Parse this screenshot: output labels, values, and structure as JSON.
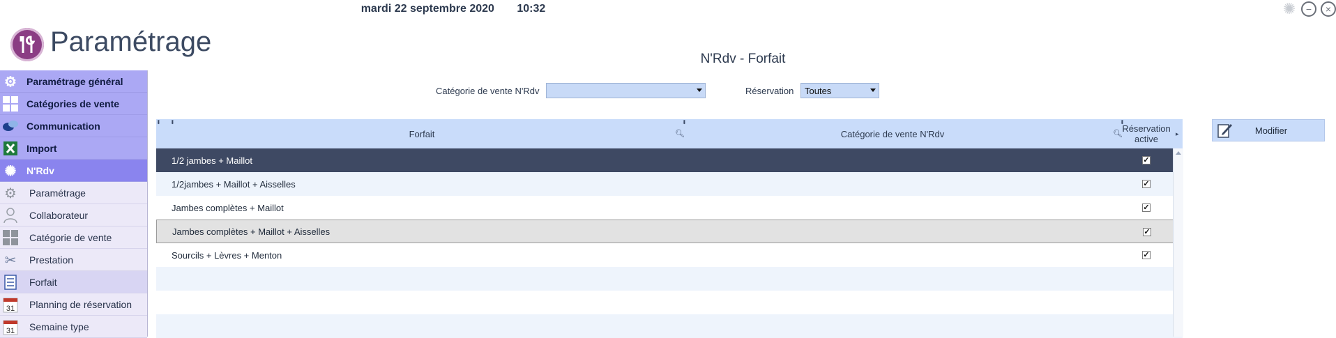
{
  "header": {
    "date": "mardi 22 septembre 2020",
    "time": "10:32",
    "app_title": "Paramétrage",
    "page_title": "N'Rdv - Forfait"
  },
  "window_controls": {
    "loading_icon": "spinner-icon",
    "minimize_icon": "minimize-icon",
    "close_icon": "close-icon"
  },
  "sidebar": {
    "main_items": [
      {
        "label": "Paramétrage général",
        "icon": "gears-icon"
      },
      {
        "label": "Catégories de vente",
        "icon": "grid-icon"
      },
      {
        "label": "Communication",
        "icon": "chat-bubbles-icon"
      },
      {
        "label": "Import",
        "icon": "excel-icon"
      },
      {
        "label": "N'Rdv",
        "icon": "nrdv-icon",
        "active": true
      }
    ],
    "sub_items": [
      {
        "label": "Paramétrage",
        "icon": "gears-icon"
      },
      {
        "label": "Collaborateur",
        "icon": "user-icon"
      },
      {
        "label": "Catégorie de vente",
        "icon": "grid-icon"
      },
      {
        "label": "Prestation",
        "icon": "scissors-icon"
      },
      {
        "label": "Forfait",
        "icon": "checklist-icon",
        "active": true
      },
      {
        "label": "Planning de réservation",
        "icon": "calendar-icon",
        "calendar_day": "31"
      },
      {
        "label": "Semaine type",
        "icon": "calendar-icon",
        "calendar_day": "31"
      }
    ]
  },
  "filters": {
    "category_label": "Catégorie de vente N'Rdv",
    "category_value": "",
    "reservation_label": "Réservation",
    "reservation_value": "Toutes"
  },
  "grid": {
    "columns": [
      "Forfait",
      "Catégorie de vente N'Rdv",
      "Réservation active"
    ],
    "rows": [
      {
        "forfait": "1/2 jambes + Maillot",
        "categorie": "",
        "reservation_active": true
      },
      {
        "forfait": "1/2jambes + Maillot + Aisselles",
        "categorie": "",
        "reservation_active": true
      },
      {
        "forfait": "Jambes complètes + Maillot",
        "categorie": "",
        "reservation_active": true
      },
      {
        "forfait": "Jambes complètes + Maillot + Aisselles",
        "categorie": "",
        "reservation_active": true
      },
      {
        "forfait": "Sourcils + Lèvres + Menton",
        "categorie": "",
        "reservation_active": true
      }
    ],
    "check_mark": "✓"
  },
  "actions": {
    "modify_label": "Modifier",
    "modify_icon": "edit-icon"
  },
  "colors": {
    "sidebar_main": "#aba8f4",
    "sidebar_active": "#8a84ee",
    "header_blue": "#c9dcfa",
    "selected_row": "#3e4963",
    "logo": "#8b3d84"
  }
}
